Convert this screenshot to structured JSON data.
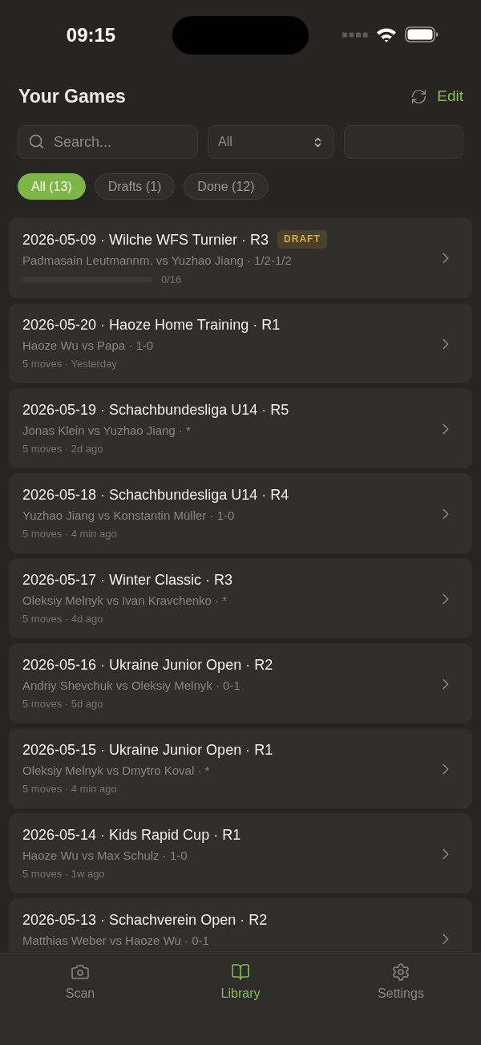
{
  "status_bar": {
    "time": "09:15"
  },
  "header": {
    "title": "Your Games",
    "edit": "Edit"
  },
  "filters": {
    "search": {
      "placeholder": "Search..."
    },
    "select": {
      "value": "All"
    }
  },
  "chips": [
    {
      "label": "All (13)",
      "selected": true
    },
    {
      "label": "Drafts (1)",
      "selected": false
    },
    {
      "label": "Done (12)",
      "selected": false
    }
  ],
  "games": [
    {
      "kind": "draft",
      "title": "2026-05-09 · Wilche WFS Turnier · R3",
      "badge": "DRAFT",
      "players": "Padmasain Leutmannm. vs Yuzhao Jiang · 1/2-1/2",
      "progress": {
        "level": 0,
        "reading": "0/16"
      }
    },
    {
      "kind": "game",
      "title": "2026-05-20 · Haoze Home Training · R1",
      "players": "Haoze Wu vs Papa · 1-0",
      "meta": "5 moves · Yesterday"
    },
    {
      "kind": "game",
      "title": "2026-05-19 · Schachbundesliga U14 · R5",
      "players": "Jonas Klein vs Yuzhao Jiang · *",
      "meta": "5 moves · 2d ago"
    },
    {
      "kind": "game",
      "title": "2026-05-18 · Schachbundesliga U14 · R4",
      "players": "Yuzhao Jiang vs Konstantin Müller · 1-0",
      "meta": "5 moves · 4 min ago"
    },
    {
      "kind": "game",
      "title": "2026-05-17 · Winter Classic · R3",
      "players": "Oleksiy Melnyk vs Ivan Kravchenko · *",
      "meta": "5 moves · 4d ago"
    },
    {
      "kind": "game",
      "title": "2026-05-16 · Ukraine Junior Open · R2",
      "players": "Andriy Shevchuk vs Oleksiy Melnyk · 0-1",
      "meta": "5 moves · 5d ago"
    },
    {
      "kind": "game",
      "title": "2026-05-15 · Ukraine Junior Open · R1",
      "players": "Oleksiy Melnyk vs Dmytro Koval · *",
      "meta": "5 moves · 4 min ago"
    },
    {
      "kind": "game",
      "title": "2026-05-14 · Kids Rapid Cup · R1",
      "players": "Haoze Wu vs Max Schulz · 1-0",
      "meta": "5 moves · 1w ago"
    },
    {
      "kind": "game",
      "title": "2026-05-13 · Schachverein Open · R2",
      "players": "Matthias Weber vs Haoze Wu · 0-1"
    }
  ],
  "tab_bar": [
    {
      "label": "Scan",
      "selected": false
    },
    {
      "label": "Library",
      "selected": true
    },
    {
      "label": "Settings",
      "selected": false
    }
  ]
}
